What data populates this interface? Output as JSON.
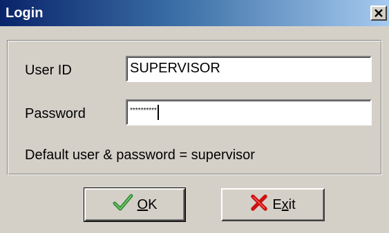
{
  "window": {
    "title": "Login",
    "close_glyph": "✕"
  },
  "form": {
    "userid_label": "User ID",
    "userid_value": "SUPERVISOR",
    "password_label": "Password",
    "password_value": "**********",
    "hint": "Default user & password = supervisor"
  },
  "buttons": {
    "ok_label": "OK",
    "ok_mnemonic": "O",
    "ok_rest": "K",
    "exit_pre": "E",
    "exit_mnemonic": "x",
    "exit_rest": "it"
  },
  "colors": {
    "check_green": "#2e8b2e",
    "x_red": "#cc1111",
    "titlebar_start": "#0a246a",
    "titlebar_end": "#a6caf0"
  },
  "icons": {
    "ok": "checkmark-icon",
    "exit": "red-x-icon",
    "close": "close-icon"
  }
}
